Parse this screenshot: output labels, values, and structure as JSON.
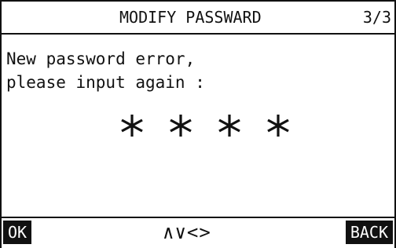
{
  "header": {
    "title": "MODIFY PASSWARD",
    "page": "3/3"
  },
  "message": {
    "line1": "New password error,",
    "line2": "please input again :"
  },
  "password": {
    "mask_chars": [
      "*",
      "*",
      "*",
      "*"
    ]
  },
  "footer": {
    "ok_label": "OK",
    "nav_label": "∧∨<>",
    "back_label": "BACK"
  }
}
